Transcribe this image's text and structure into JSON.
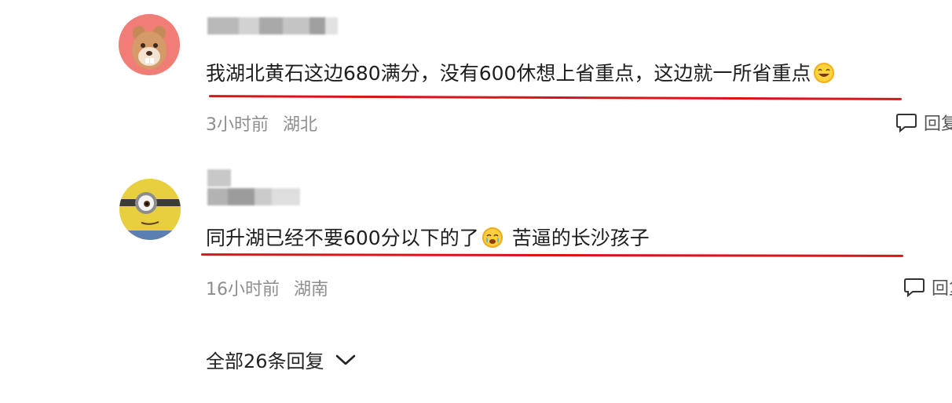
{
  "comments": [
    {
      "text": "我湖北黄石这边680满分，没有600休想上省重点，这边就一所省重点",
      "time": "3小时前",
      "location": "湖北",
      "reply_label": "回复",
      "avatar_icon": "cartoon-animal-avatar",
      "emoji_icon": "grin-emoji"
    },
    {
      "text": "同升湖已经不要600分以下的了",
      "text_after_emoji": "苦逼的长沙孩子",
      "time": "16小时前",
      "location": "湖南",
      "reply_label": "回复",
      "avatar_icon": "minion-avatar",
      "emoji_icon": "crying-emoji"
    }
  ],
  "all_replies": {
    "label": "全部26条回复",
    "icon": "chevron-down-icon"
  },
  "colors": {
    "underline": "#d9141b",
    "meta": "#8e8e8e"
  }
}
